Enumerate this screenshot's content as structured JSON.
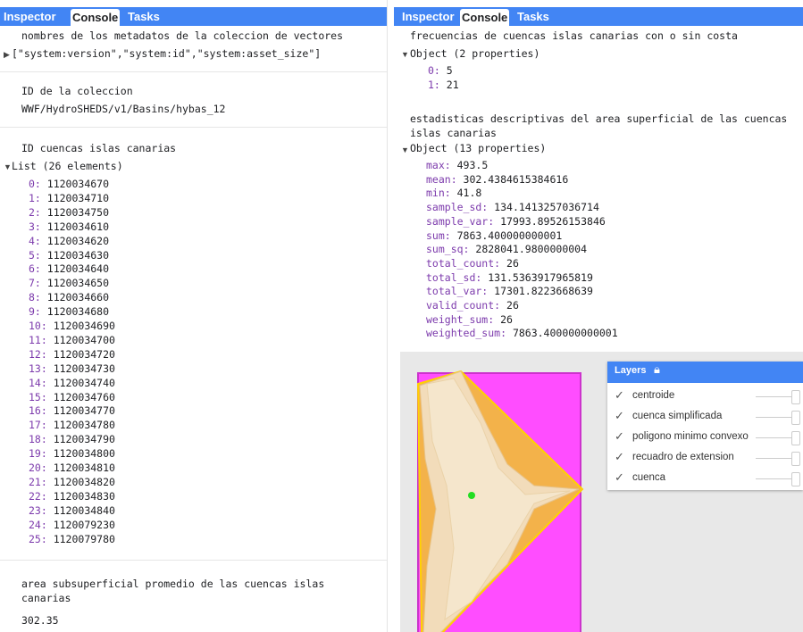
{
  "left": {
    "tabs": [
      "Inspector",
      "Console",
      "Tasks"
    ],
    "metadata_title": "nombres de los metadatos de la coleccion de vectores",
    "metadata_list": "[\"system:version\",\"system:id\",\"system:asset_size\"]",
    "collection_title": "ID de la coleccion",
    "collection_id": "WWF/HydroSHEDS/v1/Basins/hybas_12",
    "basins_title": "ID cuencas islas canarias",
    "basins_list_header": "List (26 elements)",
    "basin_ids": [
      "0: 1120034670",
      "1: 1120034710",
      "2: 1120034750",
      "3: 1120034610",
      "4: 1120034620",
      "5: 1120034630",
      "6: 1120034640",
      "7: 1120034650",
      "8: 1120034660",
      "9: 1120034680",
      "10: 1120034690",
      "11: 1120034700",
      "12: 1120034720",
      "13: 1120034730",
      "14: 1120034740",
      "15: 1120034760",
      "16: 1120034770",
      "17: 1120034780",
      "18: 1120034790",
      "19: 1120034800",
      "20: 1120034810",
      "21: 1120034820",
      "22: 1120034830",
      "23: 1120034840",
      "24: 1120079230",
      "25: 1120079780"
    ],
    "area_title_1": "area subsuperficial promedio de las cuencas islas",
    "area_title_2": "canarias",
    "area_value": "302.35"
  },
  "right": {
    "tabs": [
      "Inspector",
      "Console",
      "Tasks"
    ],
    "freq_title": "frecuencias de cuencas islas canarias con o sin costa",
    "freq_object": "Object (2 properties)",
    "freq_items": [
      {
        "k": "0",
        "v": "5"
      },
      {
        "k": "1",
        "v": "21"
      }
    ],
    "stats_title_1": "estadisticas descriptivas del area superficial de las cuencas",
    "stats_title_2": "islas canarias",
    "stats_object": "Object (13 properties)",
    "stats_items": [
      {
        "k": "max",
        "v": "493.5"
      },
      {
        "k": "mean",
        "v": "302.4384615384616"
      },
      {
        "k": "min",
        "v": "41.8"
      },
      {
        "k": "sample_sd",
        "v": "134.1413257036714"
      },
      {
        "k": "sample_var",
        "v": "17993.89526153846"
      },
      {
        "k": "sum",
        "v": "7863.400000000001"
      },
      {
        "k": "sum_sq",
        "v": "2828041.9800000004"
      },
      {
        "k": "total_count",
        "v": "26"
      },
      {
        "k": "total_sd",
        "v": "131.5363917965819"
      },
      {
        "k": "total_var",
        "v": "17301.8223668639"
      },
      {
        "k": "valid_count",
        "v": "26"
      },
      {
        "k": "weight_sum",
        "v": "26"
      },
      {
        "k": "weighted_sum",
        "v": "7863.400000000001"
      }
    ]
  },
  "layers": {
    "title": "Layers",
    "items": [
      "centroide",
      "cuenca simplificada",
      "poligono minimo convexo",
      "recuadro de extension",
      "cuenca"
    ]
  },
  "colors": {
    "accent": "#4285f4",
    "key": "#7c3aac",
    "extent_box": "#ff4dff",
    "convex_hull": "#f3b24a",
    "basin": "#f2dfc0",
    "centroid": "#22dd22"
  }
}
